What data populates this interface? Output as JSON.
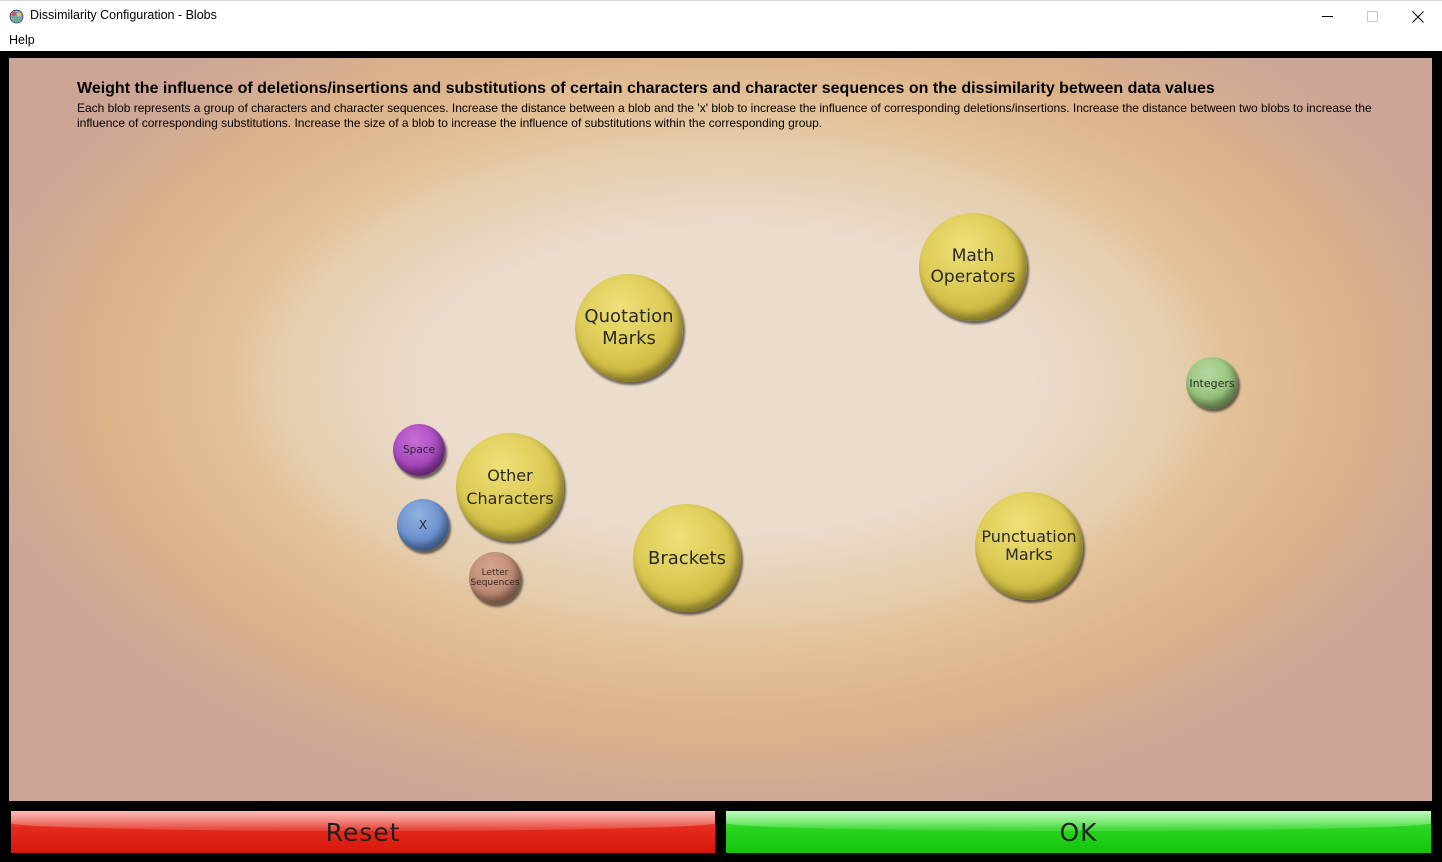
{
  "window": {
    "title": "Dissimilarity Configuration - Blobs",
    "icon": "gear-cluster-icon",
    "controls": [
      "minimize-icon",
      "maximize-icon",
      "close-icon"
    ]
  },
  "menu": {
    "items": [
      {
        "label": "Help"
      }
    ]
  },
  "content": {
    "heading": "Weight the influence of deletions/insertions and substitutions of certain characters and character sequences on the dissimilarity between data values",
    "description": "Each blob represents a group of characters and character sequences. Increase the distance between a blob and the 'x' blob to increase the influence of corresponding deletions/insertions. Increase the distance between two blobs to increase the influence of corresponding substitutions. Increase the size of a blob to increase the influence of substitutions within the corresponding group."
  },
  "blobs": {
    "math_operators": {
      "line1": "Math",
      "line2": "Operators",
      "color": "#dccb55"
    },
    "quotation_marks": {
      "line1": "Quotation",
      "line2": "Marks",
      "color": "#dccb55"
    },
    "integers": {
      "label": "Integers",
      "color": "#97c27b"
    },
    "space": {
      "label": "Space",
      "color": "#a647bd"
    },
    "other_characters": {
      "line1": "Other",
      "line2": "Characters",
      "color": "#dccb55"
    },
    "x": {
      "label": "X",
      "color": "#6a91cf"
    },
    "letter_sequences": {
      "line1": "Letter",
      "line2": "Sequences",
      "color": "#bf8a73"
    },
    "brackets": {
      "label": "Brackets",
      "color": "#dccb55"
    },
    "punctuation_marks": {
      "line1": "Punctuation",
      "line2": "Marks",
      "color": "#dccb55"
    }
  },
  "buttons": {
    "reset": {
      "label": "Reset",
      "color": "#e52a1d"
    },
    "ok": {
      "label": "OK",
      "color": "#28d51f"
    }
  }
}
